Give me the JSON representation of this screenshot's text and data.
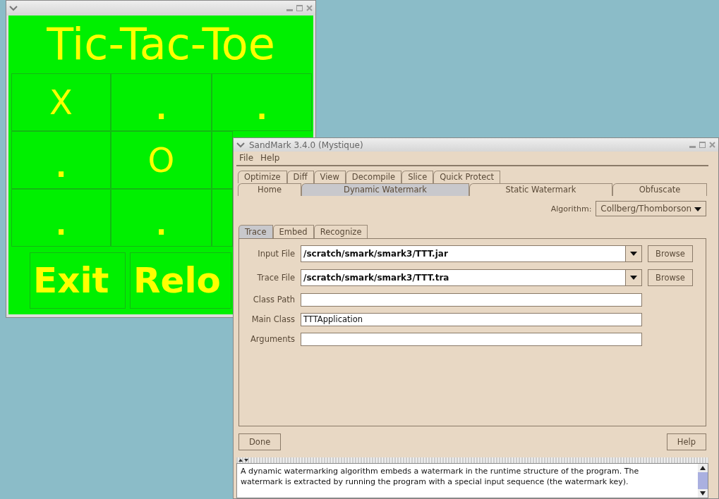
{
  "tictactoe_window": {
    "title": "Tic-Tac-Toe",
    "board": [
      [
        "X",
        ".",
        "."
      ],
      [
        ".",
        "O"
      ],
      [
        ".",
        "."
      ]
    ],
    "buttons": [
      "Exit",
      "Relo"
    ]
  },
  "sandmark_window": {
    "title": "SandMark 3.4.0 (Mystique)",
    "menu": [
      "File",
      "Help"
    ],
    "tab_rows": [
      [
        {
          "label": "Optimize",
          "selected": false
        },
        {
          "label": "Diff",
          "selected": false
        },
        {
          "label": "View",
          "selected": false
        },
        {
          "label": "Decompile",
          "selected": false
        },
        {
          "label": "Slice",
          "selected": false
        },
        {
          "label": "Quick Protect",
          "selected": false
        }
      ],
      [
        {
          "label": "Home",
          "selected": false
        },
        {
          "label": "Dynamic Watermark",
          "selected": true
        },
        {
          "label": "Static Watermark",
          "selected": false
        },
        {
          "label": "Obfuscate",
          "selected": false
        }
      ]
    ],
    "algorithm": {
      "label": "Algorithm:",
      "value": "Collberg/Thomborson"
    },
    "subtabs": [
      {
        "label": "Trace",
        "selected": true
      },
      {
        "label": "Embed",
        "selected": false
      },
      {
        "label": "Recognize",
        "selected": false
      }
    ],
    "fields": [
      {
        "label": "Input File",
        "value": "/scratch/smark/smark3/TTT.jar",
        "kind": "combo",
        "button": "Browse"
      },
      {
        "label": "Trace File",
        "value": "/scratch/smark/smark3/TTT.tra",
        "kind": "combo",
        "button": "Browse"
      },
      {
        "label": "Class Path",
        "kind": "text"
      },
      {
        "label": "Main Class",
        "value": "TTTApplication",
        "kind": "text"
      },
      {
        "label": "Arguments",
        "kind": "text"
      }
    ],
    "buttons": [
      "Done",
      "Help"
    ],
    "description": "A dynamic watermarking algorithm embeds a watermark in the runtime structure of the program. The watermark is extracted by running the program with a special input sequence (the watermark key)."
  }
}
